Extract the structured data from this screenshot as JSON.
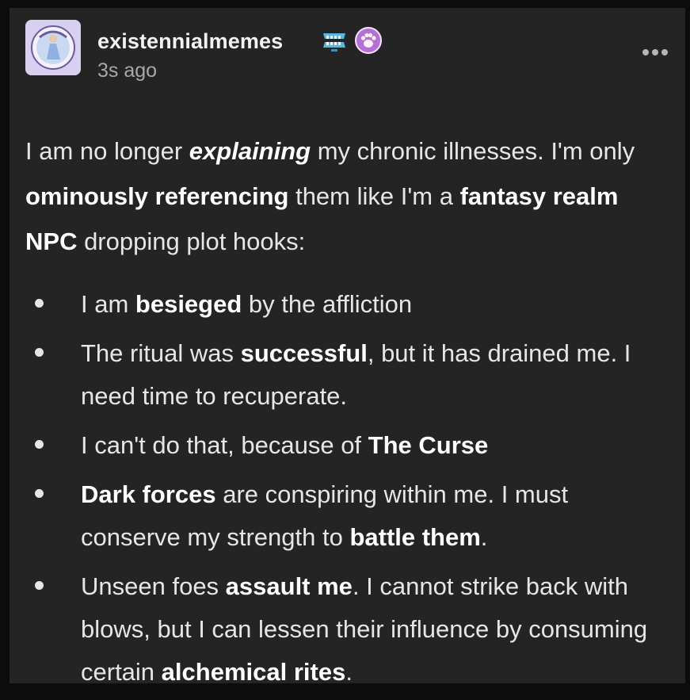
{
  "post": {
    "username": "existennialmemes",
    "timestamp": "3s ago",
    "badges": [
      "teeth-badge-icon",
      "paw-badge-icon"
    ],
    "colors": {
      "background": "#242424",
      "text": "#e6e6e6",
      "muted": "#a8a8a8"
    }
  },
  "content": {
    "intro": [
      {
        "text": "I am no longer ",
        "style": "normal"
      },
      {
        "text": "explaining",
        "style": "bold-italic"
      },
      {
        "text": " my chronic illnesses. I'm only ",
        "style": "normal"
      },
      {
        "text": "ominously referencing",
        "style": "bold"
      },
      {
        "text": " them like I'm a ",
        "style": "normal"
      },
      {
        "text": "fantasy realm NPC",
        "style": "bold"
      },
      {
        "text": " dropping plot hooks:",
        "style": "normal"
      }
    ],
    "items": [
      [
        {
          "text": "I am ",
          "style": "normal"
        },
        {
          "text": "besieged",
          "style": "bold"
        },
        {
          "text": " by the affliction",
          "style": "normal"
        }
      ],
      [
        {
          "text": "The ritual was ",
          "style": "normal"
        },
        {
          "text": "successful",
          "style": "bold"
        },
        {
          "text": ", but it has drained me. I need time to recuperate.",
          "style": "normal"
        }
      ],
      [
        {
          "text": "I can't do that, because of ",
          "style": "normal"
        },
        {
          "text": "The Curse",
          "style": "bold"
        }
      ],
      [
        {
          "text": "Dark forces",
          "style": "bold"
        },
        {
          "text": " are conspiring within me. I must conserve my strength to ",
          "style": "normal"
        },
        {
          "text": "battle them",
          "style": "bold"
        },
        {
          "text": ".",
          "style": "normal"
        }
      ],
      [
        {
          "text": "Unseen foes ",
          "style": "normal"
        },
        {
          "text": "assault me",
          "style": "bold"
        },
        {
          "text": ". I cannot strike back with blows, but I can lessen their influence by consuming certain ",
          "style": "normal"
        },
        {
          "text": "alchemical rites",
          "style": "bold"
        },
        {
          "text": ".",
          "style": "normal"
        }
      ]
    ]
  }
}
